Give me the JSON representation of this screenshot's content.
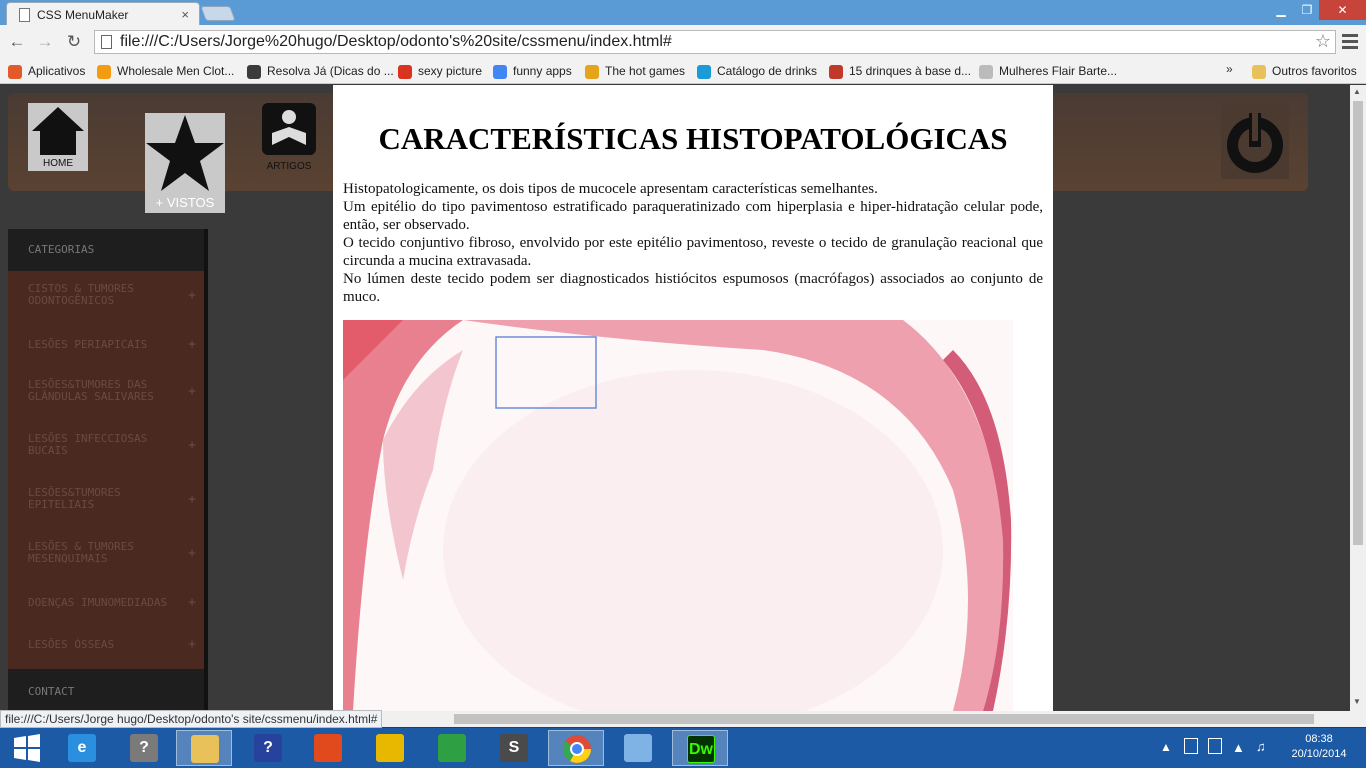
{
  "browser": {
    "tab_title": "CSS MenuMaker",
    "close_symbol": "×",
    "url": "file:///C:/Users/Jorge%20hugo/Desktop/odonto's%20site/cssmenu/index.html#",
    "window_min": "▁",
    "window_max": "❐",
    "window_close": "✕",
    "bookmarks": [
      {
        "label": "Aplicativos",
        "icon": "apps-grid-icon",
        "color": "#e25a2c"
      },
      {
        "label": "Wholesale Men Clot...",
        "icon": "cart-icon",
        "color": "#f39c12"
      },
      {
        "label": "Resolva Já (Dicas do ...",
        "icon": "eye-icon",
        "color": "#3b3b3b"
      },
      {
        "label": "sexy picture",
        "icon": "pin-icon",
        "color": "#d9331f"
      },
      {
        "label": "funny apps",
        "icon": "google-icon",
        "color": "#4285f4"
      },
      {
        "label": "The hot games",
        "icon": "game-icon",
        "color": "#e4a51c"
      },
      {
        "label": "Catálogo de drinks",
        "icon": "k-icon",
        "color": "#1a9ad6"
      },
      {
        "label": "15 drinques à base d...",
        "icon": "drink-icon",
        "color": "#c0392b"
      },
      {
        "label": "Mulheres Flair Barte...",
        "icon": "page-icon",
        "color": "#bbbbbb"
      }
    ],
    "more_bookmarks": "»",
    "other_bookmarks": "Outros favoritos",
    "status_url": "file:///C:/Users/Jorge hugo/Desktop/odonto's site/cssmenu/index.html#"
  },
  "header": {
    "home_label": "HOME",
    "vistos_label": "+ VISTOS",
    "artigos_label": "ARTIGOS"
  },
  "sidebar": {
    "heading": "CATEGORIAS",
    "items": [
      {
        "line1": "CISTOS & TUMORES",
        "line2": "ODONTOGÊNICOS"
      },
      {
        "line1": "LESÕES PERIAPICAIS",
        "line2": ""
      },
      {
        "line1": "LESÕES&TUMORES DAS",
        "line2": "GLÂNDULAS SALIVARES"
      },
      {
        "line1": "LESÕES INFECCIOSAS",
        "line2": "BUCAIS"
      },
      {
        "line1": "LESÕES&TUMORES",
        "line2": "EPITELIAIS"
      },
      {
        "line1": "LESÕES & TUMORES",
        "line2": "MESENQUIMAIS"
      },
      {
        "line1": "DOENÇAS IMUNOMEDIADAS",
        "line2": ""
      },
      {
        "line1": "LESÕES ÓSSEAS",
        "line2": ""
      }
    ],
    "plus": "+",
    "contact": "CONTACT"
  },
  "content": {
    "title": "CARACTERÍSTICAS HISTOPATOLÓGICAS",
    "paragraphs": [
      "Histopatologicamente, os dois tipos de mucocele apresentam características semelhantes.",
      "Um epitélio do tipo pavimentoso estratificado paraqueratinizado com hiperplasia e hiper-hidratação celular pode, então, ser observado.",
      "O tecido conjuntivo fibroso, envolvido por este epitélio pavimentoso, reveste o tecido de granulação reacional que circunda a mucina extravasada.",
      "No lúmen deste tecido podem ser diagnosticados histiócitos espumosos (macrófagos) associados ao conjunto de muco."
    ]
  },
  "taskbar": {
    "apps": [
      {
        "name": "start",
        "glyph": "",
        "color": "#1c5aa6"
      },
      {
        "name": "ie",
        "glyph": "e",
        "color": "#2b8fe0"
      },
      {
        "name": "help",
        "glyph": "?",
        "color": "#7a7a7a"
      },
      {
        "name": "explorer",
        "glyph": "",
        "color": "#e8c15a"
      },
      {
        "name": "support",
        "glyph": "?",
        "color": "#27429c"
      },
      {
        "name": "office",
        "glyph": "",
        "color": "#e04a1c"
      },
      {
        "name": "network",
        "glyph": "",
        "color": "#e8b800"
      },
      {
        "name": "store",
        "glyph": "",
        "color": "#2ea043"
      },
      {
        "name": "sublime",
        "glyph": "S",
        "color": "#4a4a4a"
      },
      {
        "name": "chrome",
        "glyph": "",
        "color": "#dd4b39"
      },
      {
        "name": "paint",
        "glyph": "",
        "color": "#7fb2e5"
      },
      {
        "name": "dreamweaver",
        "glyph": "Dw",
        "color": "#35fa00"
      }
    ],
    "time": "08:38",
    "date": "20/10/2014"
  }
}
